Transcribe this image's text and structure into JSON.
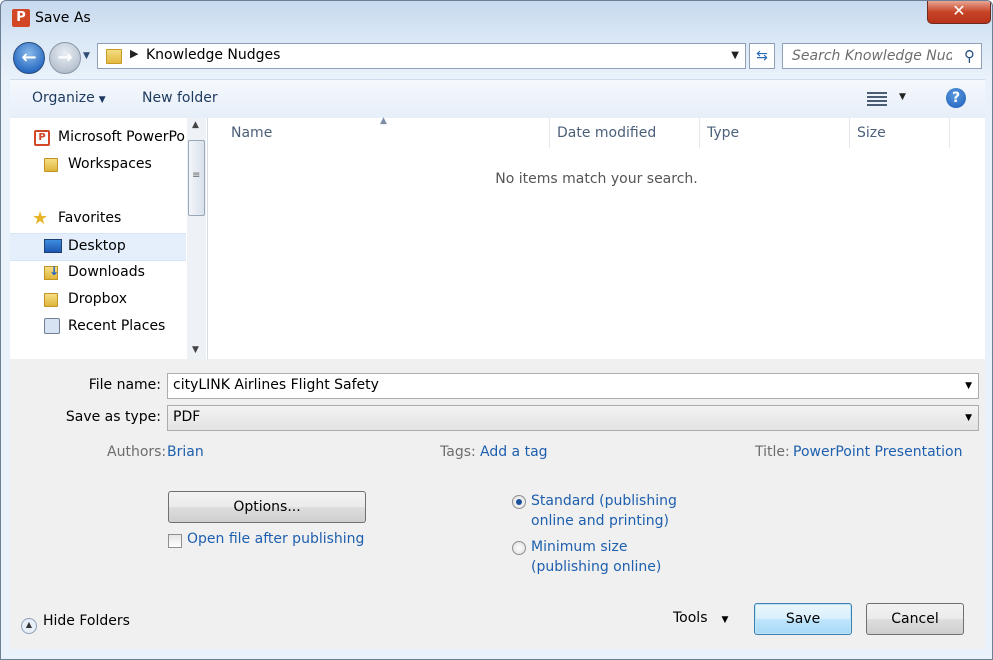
{
  "window": {
    "title": "Save As",
    "app_icon": "P",
    "close_label": "✕"
  },
  "address": {
    "path": "Knowledge Nudges"
  },
  "search": {
    "placeholder": "Search Knowledge Nudges"
  },
  "toolbar": {
    "organize_label": "Organize",
    "new_folder_label": "New folder",
    "help_label": "?"
  },
  "nav": {
    "items": [
      {
        "label": "Microsoft PowerPo",
        "icon": "powerpoint-icon"
      },
      {
        "label": "Workspaces",
        "icon": "folder-icon"
      },
      {
        "label": "Favorites",
        "icon": "star-icon"
      },
      {
        "label": "Desktop",
        "icon": "desktop-icon"
      },
      {
        "label": "Downloads",
        "icon": "downloads-folder-icon"
      },
      {
        "label": "Dropbox",
        "icon": "folder-icon"
      },
      {
        "label": "Recent Places",
        "icon": "recent-places-icon"
      }
    ]
  },
  "file_list": {
    "columns": [
      "Name",
      "Date modified",
      "Type",
      "Size"
    ],
    "empty_message": "No items match your search."
  },
  "form": {
    "file_name_label": "File name:",
    "file_name_value": "cityLINK Airlines Flight Safety",
    "save_type_label": "Save as type:",
    "save_type_value": "PDF",
    "authors_label": "Authors:",
    "authors_value": "Brian",
    "tags_label": "Tags:",
    "tags_value": "Add a tag",
    "title_label": "Title:",
    "title_value": "PowerPoint Presentation",
    "options_button": "Options...",
    "open_after_label": "Open file after publishing",
    "open_after_checked": false,
    "radio_standard_line1": "Standard (publishing",
    "radio_standard_line2": "online and printing)",
    "radio_minimum_line1": "Minimum size",
    "radio_minimum_line2": "(publishing online)",
    "selected_option": "standard"
  },
  "footer": {
    "hide_folders_label": "Hide Folders",
    "tools_label": "Tools",
    "save_label": "Save",
    "cancel_label": "Cancel"
  }
}
